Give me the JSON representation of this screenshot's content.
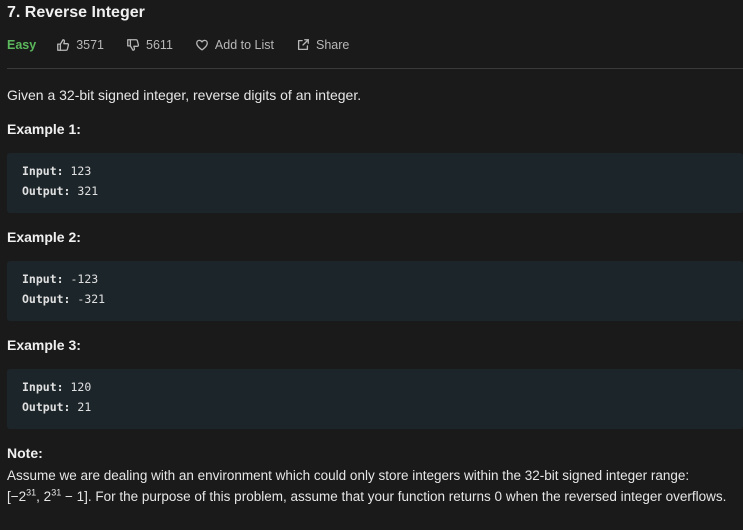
{
  "problem": {
    "title": "7. Reverse Integer",
    "difficulty": "Easy",
    "likes": "3571",
    "dislikes": "5611",
    "add_to_list": "Add to List",
    "share": "Share",
    "description": "Given a 32-bit signed integer, reverse digits of an integer."
  },
  "examples": [
    {
      "title": "Example 1:",
      "input_label": "Input:",
      "input": "123",
      "output_label": "Output:",
      "output": "321"
    },
    {
      "title": "Example 2:",
      "input_label": "Input:",
      "input": "-123",
      "output_label": "Output:",
      "output": "-321"
    },
    {
      "title": "Example 3:",
      "input_label": "Input:",
      "input": "120",
      "output_label": "Output:",
      "output": "21"
    }
  ],
  "note": {
    "title": "Note:",
    "line1": "Assume we are dealing with an environment which could only store integers within the 32-bit signed integer range:",
    "range_open": "[−2",
    "exp1": "31",
    "range_mid": ",  2",
    "exp2": "31",
    "range_close": " − 1]",
    "line2": ". For the purpose of this problem, assume that your function returns 0 when the reversed integer overflows."
  },
  "icons": {
    "likes": "thumbs-up-icon",
    "dislikes": "thumbs-down-icon",
    "add_to_list": "heart-icon",
    "share": "share-icon"
  },
  "colors": {
    "background": "#1a1a1a",
    "code_background": "#1c252a",
    "easy": "#5cb85c"
  }
}
